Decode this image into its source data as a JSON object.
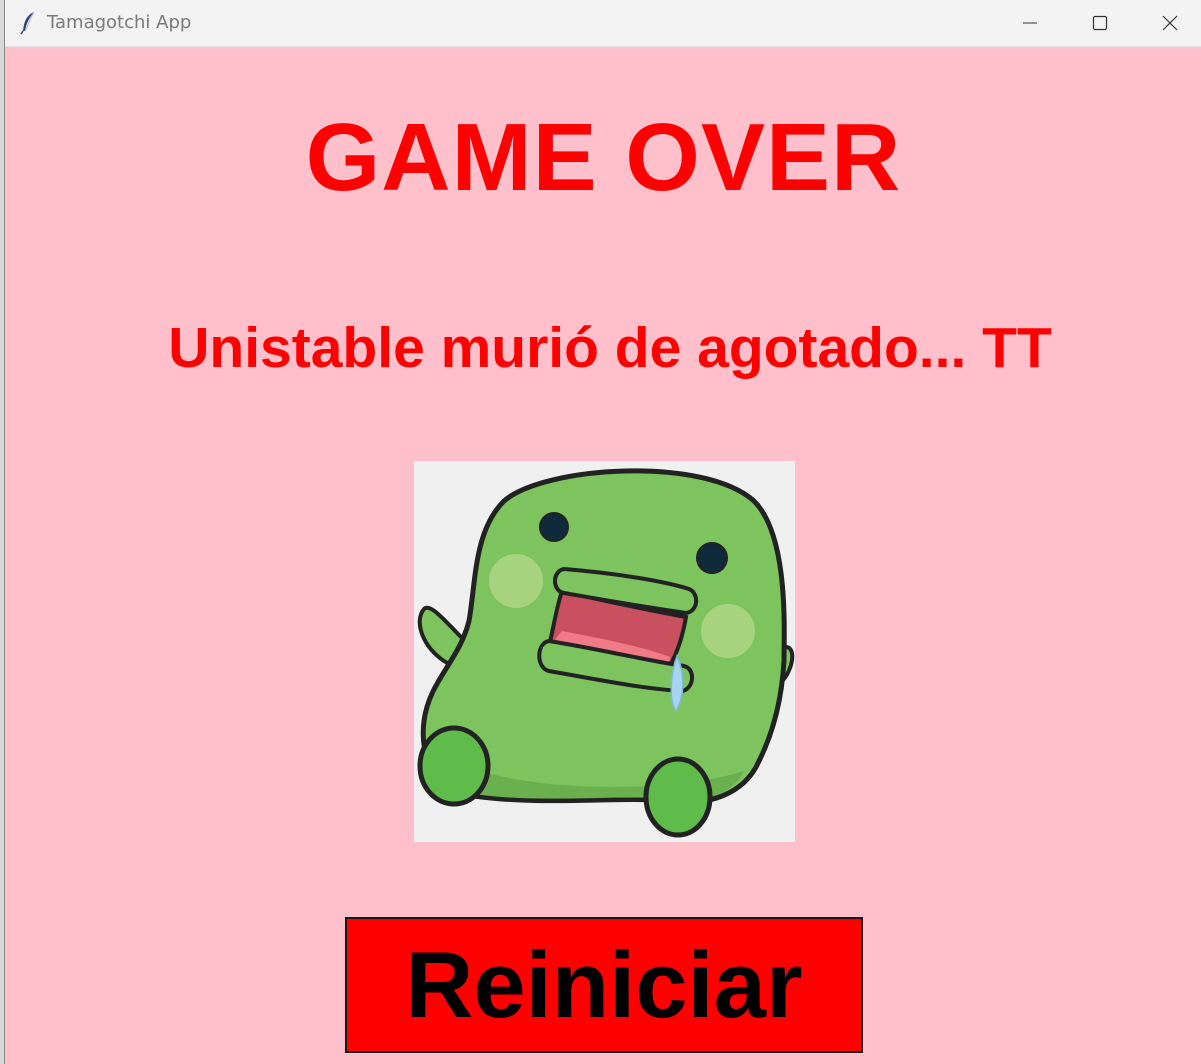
{
  "window": {
    "title": "Tamagotchi App",
    "background_color": "#ffc0cb",
    "app_icon": "feather-icon",
    "controls": [
      "minimize-icon",
      "maximize-icon",
      "close-icon"
    ]
  },
  "screen": {
    "heading": "GAME OVER",
    "message": "Unistable murió de agotado... TT",
    "text_color": "#ff0000",
    "pet_image": "green-pet-illustration",
    "restart_button": {
      "label": "Reiniciar",
      "background_color": "#ff0000"
    }
  }
}
